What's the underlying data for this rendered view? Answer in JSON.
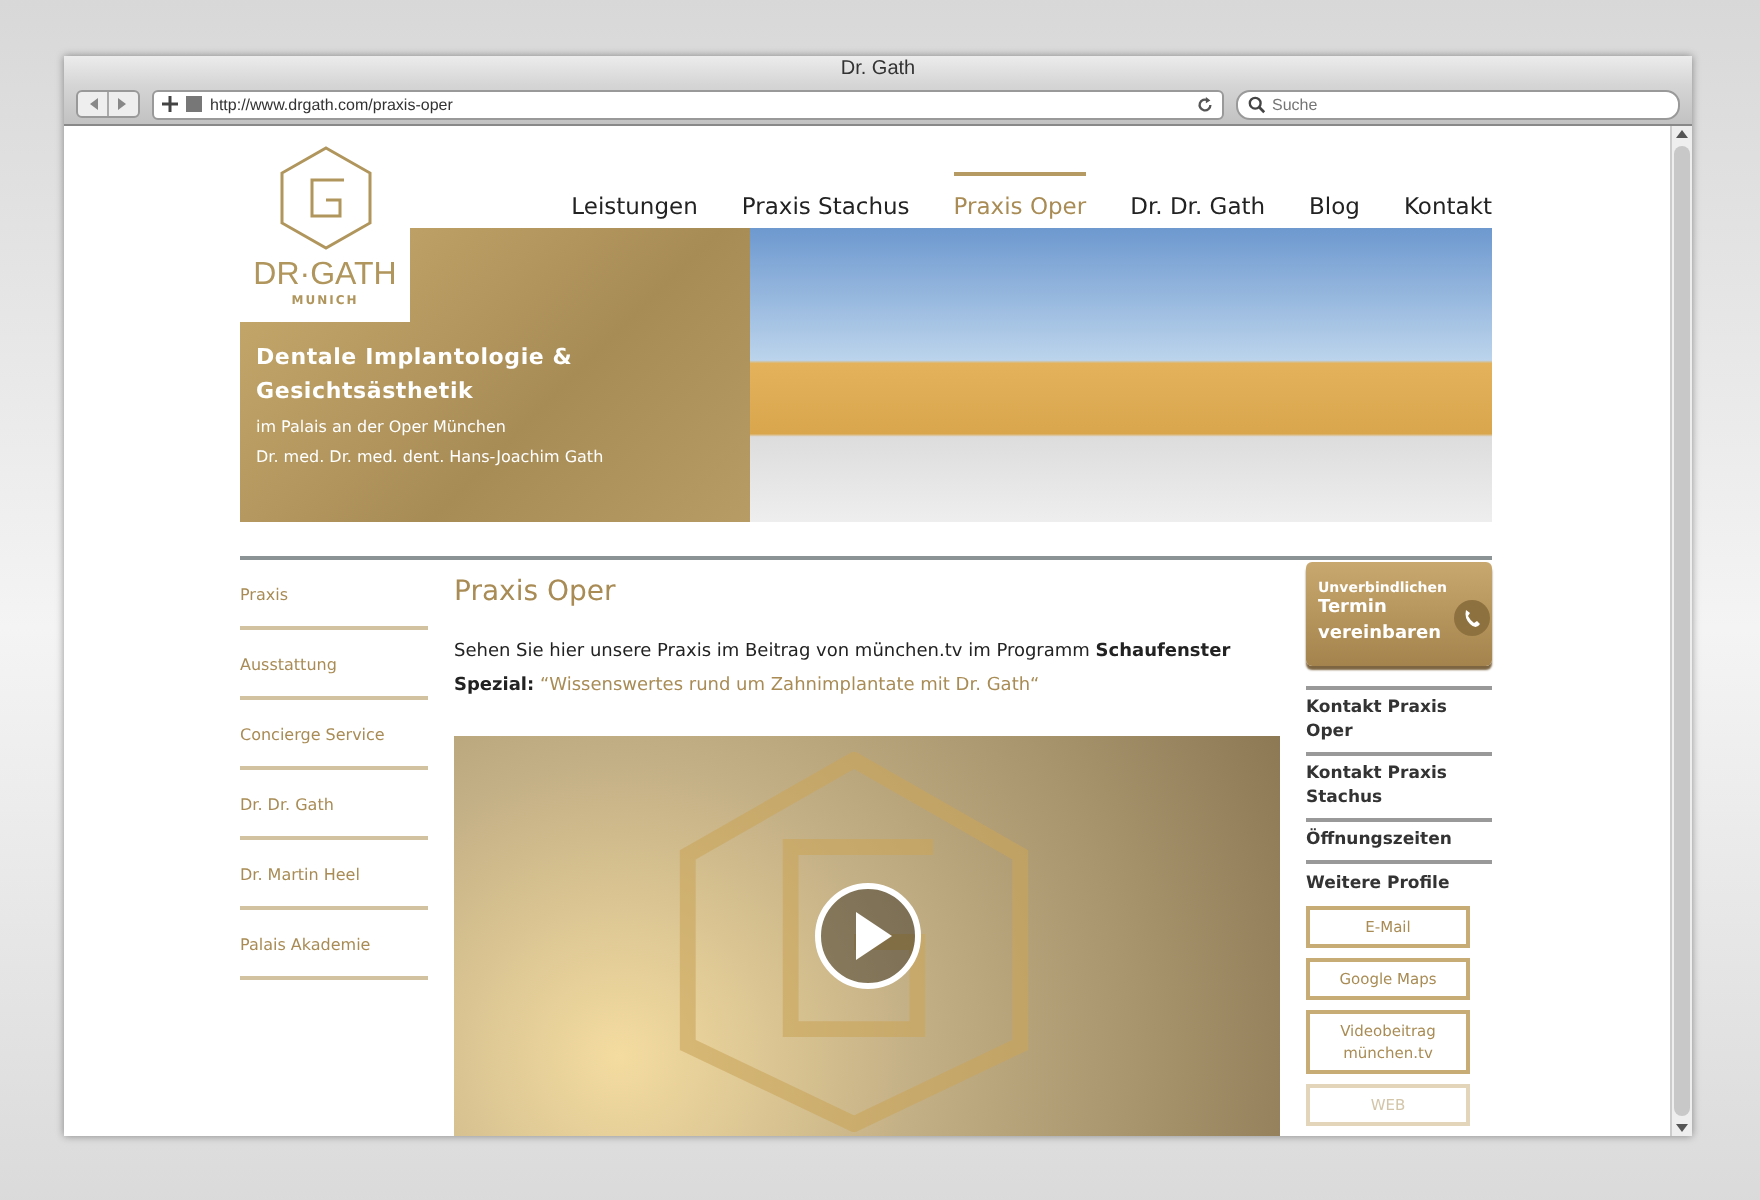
{
  "window": {
    "title": "Dr. Gath"
  },
  "toolbar": {
    "url": "http://www.drgath.com/praxis-oper",
    "search": {
      "placeholder": "Suche"
    }
  },
  "logo": {
    "name": "DR·GATH",
    "city": "MUNICH"
  },
  "nav": [
    {
      "label": "Leistungen",
      "selected": false
    },
    {
      "label": "Praxis Stachus",
      "selected": false
    },
    {
      "label": "Praxis Oper",
      "selected": true
    },
    {
      "label": "Dr. Dr. Gath",
      "selected": false
    },
    {
      "label": "Blog",
      "selected": false
    },
    {
      "label": "Kontakt",
      "selected": false
    }
  ],
  "hero": {
    "title": "Dentale Implantologie & Gesichtsästhetik",
    "subtitle": "im Palais an der Oper München",
    "doctor": "Dr. med. Dr. med. dent. Hans-Joachim Gath"
  },
  "sidebar": {
    "items": [
      "Praxis",
      "Ausstattung",
      "Concierge Service",
      "Dr. Dr. Gath",
      "Dr. Martin Heel",
      "Palais Akademie"
    ]
  },
  "main": {
    "heading": "Praxis Oper",
    "text": "Sehen Sie hier unsere Praxis im Beitrag von münchen.tv im Programm **Schaufenster Spezial:** ",
    "link": "“Wissenswertes rund um Zahnimplantate mit Dr. Gath“"
  },
  "appointment": {
    "small": "Unverbindlichen",
    "big": "Termin vereinbaren"
  },
  "contact_links": [
    "Kontakt Praxis Oper",
    "Kontakt Praxis Stachus",
    "Öffnungszeiten"
  ],
  "profiles": {
    "heading": "Weitere Profile",
    "buttons": [
      "E-Mail",
      "Google Maps",
      "Videobeitrag münchen.tv",
      "WEB"
    ]
  }
}
